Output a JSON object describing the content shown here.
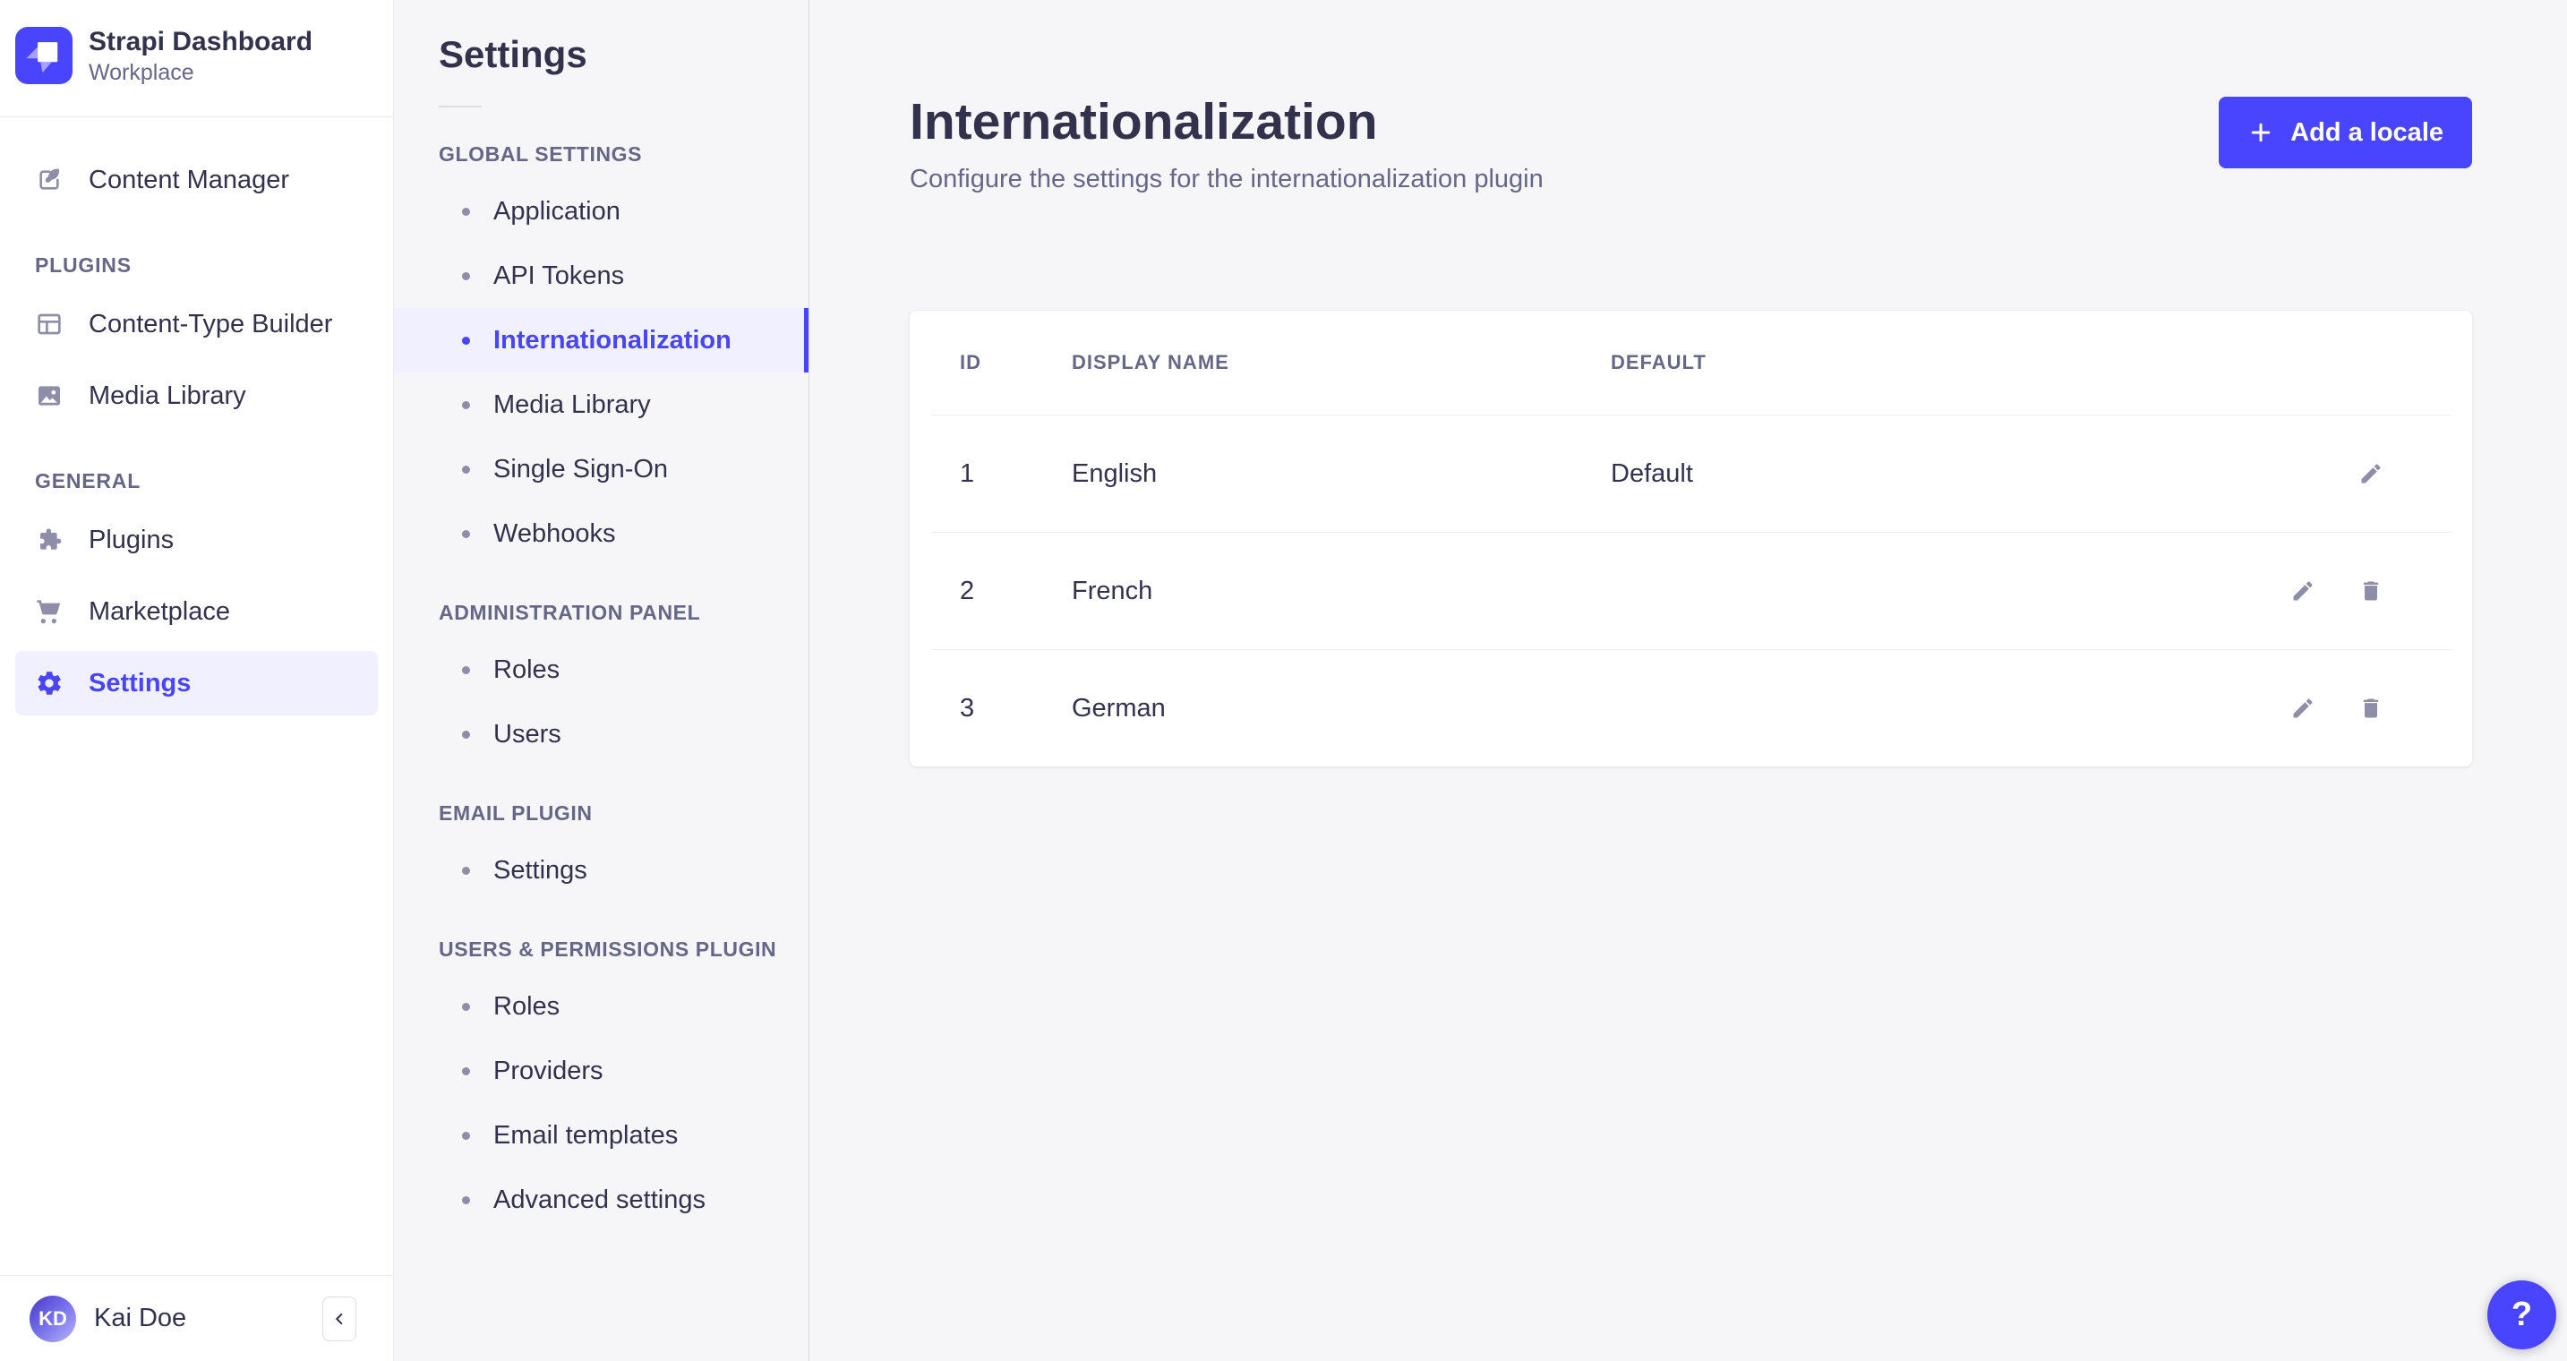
{
  "colors": {
    "primary": "#4945ff",
    "primary_light_bg": "#f0f0ff",
    "text_dark": "#32324d",
    "text_muted": "#666687",
    "icon_gray": "#8e8ea9",
    "border": "#eaeaef",
    "app_bg": "#f6f6f9",
    "card_bg": "#ffffff"
  },
  "brand": {
    "title": "Strapi Dashboard",
    "subtitle": "Workplace"
  },
  "main_nav": {
    "content_manager": {
      "label": "Content Manager",
      "icon": "content-manager-icon"
    },
    "sections": [
      {
        "label": "PLUGINS",
        "items": [
          {
            "label": "Content-Type Builder",
            "icon": "content-type-builder-icon",
            "active": false
          },
          {
            "label": "Media Library",
            "icon": "media-library-icon",
            "active": false
          }
        ]
      },
      {
        "label": "GENERAL",
        "items": [
          {
            "label": "Plugins",
            "icon": "plugins-icon",
            "active": false
          },
          {
            "label": "Marketplace",
            "icon": "marketplace-icon",
            "active": false
          },
          {
            "label": "Settings",
            "icon": "gear-icon",
            "active": true
          }
        ]
      }
    ],
    "footer": {
      "user_initials": "KD",
      "user_name": "Kai Doe"
    }
  },
  "subnav": {
    "title": "Settings",
    "sections": [
      {
        "label": "GLOBAL SETTINGS",
        "items": [
          {
            "label": "Application",
            "active": false
          },
          {
            "label": "API Tokens",
            "active": false
          },
          {
            "label": "Internationalization",
            "active": true
          },
          {
            "label": "Media Library",
            "active": false
          },
          {
            "label": "Single Sign-On",
            "active": false
          },
          {
            "label": "Webhooks",
            "active": false
          }
        ]
      },
      {
        "label": "ADMINISTRATION PANEL",
        "items": [
          {
            "label": "Roles",
            "active": false
          },
          {
            "label": "Users",
            "active": false
          }
        ]
      },
      {
        "label": "EMAIL PLUGIN",
        "items": [
          {
            "label": "Settings",
            "active": false
          }
        ]
      },
      {
        "label": "USERS & PERMISSIONS PLUGIN",
        "items": [
          {
            "label": "Roles",
            "active": false
          },
          {
            "label": "Providers",
            "active": false
          },
          {
            "label": "Email templates",
            "active": false
          },
          {
            "label": "Advanced settings",
            "active": false
          }
        ]
      }
    ]
  },
  "content": {
    "title": "Internationalization",
    "subtitle": "Configure the settings for the internationalization plugin",
    "add_button_label": "Add a locale",
    "table": {
      "headers": [
        "ID",
        "DISPLAY NAME",
        "DEFAULT"
      ],
      "rows": [
        {
          "id": "1",
          "display_name": "English",
          "default": "Default",
          "actions": [
            "edit"
          ]
        },
        {
          "id": "2",
          "display_name": "French",
          "default": "",
          "actions": [
            "edit",
            "delete"
          ]
        },
        {
          "id": "3",
          "display_name": "German",
          "default": "",
          "actions": [
            "edit",
            "delete"
          ]
        }
      ]
    },
    "help_label": "?"
  }
}
